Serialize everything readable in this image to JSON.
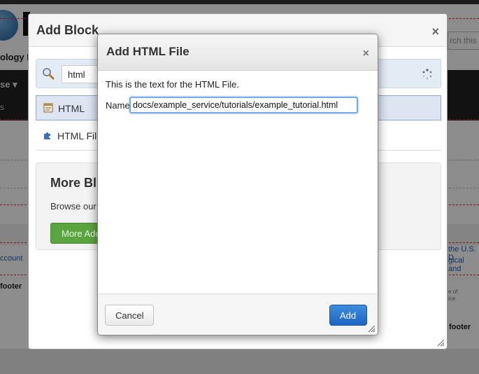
{
  "background": {
    "logo_text": "ology I",
    "search_placeholder": "rch this",
    "nav_item": "se",
    "nav_sub": "s",
    "links": [
      "ccount",
      "the U.S. D",
      "gical and"
    ],
    "footers": [
      "footer",
      "footer"
    ],
    "small_texts": [
      "e of",
      "ice"
    ]
  },
  "add_block_dialog": {
    "title": "Add Block",
    "close_glyph": "×",
    "search": {
      "value": "html"
    },
    "blocks": [
      {
        "label": "HTML",
        "selected": true
      },
      {
        "label": "HTML File",
        "selected": false
      }
    ],
    "more": {
      "title": "More Bl",
      "text": "Browse our",
      "button_label": "More Add"
    }
  },
  "add_html_file_dialog": {
    "title": "Add HTML File",
    "close_glyph": "×",
    "description": "This is the text for the HTML File.",
    "name_label": "Name",
    "name_value": "docs/example_service/tutorials/example_tutorial.html",
    "cancel_label": "Cancel",
    "add_label": "Add"
  },
  "colors": {
    "primary_button": "#1d64c4",
    "green_button": "#5aa540",
    "selected_row": "#dde5f3",
    "focus_ring": "#78a8e6"
  }
}
